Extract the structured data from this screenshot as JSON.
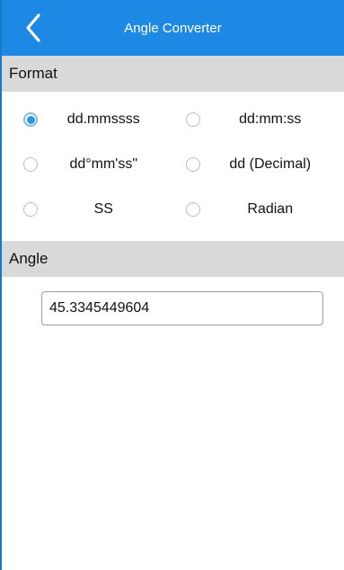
{
  "header": {
    "title": "Angle Converter",
    "back_icon": "chevron-left-icon"
  },
  "format": {
    "section_label": "Format",
    "options": [
      {
        "label": "dd.mmssss",
        "checked": true
      },
      {
        "label": "dd:mm:ss",
        "checked": false
      },
      {
        "label": "dd°mm'ss\"",
        "checked": false
      },
      {
        "label": "dd (Decimal)",
        "checked": false
      },
      {
        "label": "SS",
        "checked": false
      },
      {
        "label": "Radian",
        "checked": false
      }
    ]
  },
  "angle": {
    "section_label": "Angle",
    "value": "45.3345449604"
  },
  "colors": {
    "header": "#1e88e5",
    "section_bg": "#d9d9d9",
    "radio_checked": "#2f95e2"
  }
}
